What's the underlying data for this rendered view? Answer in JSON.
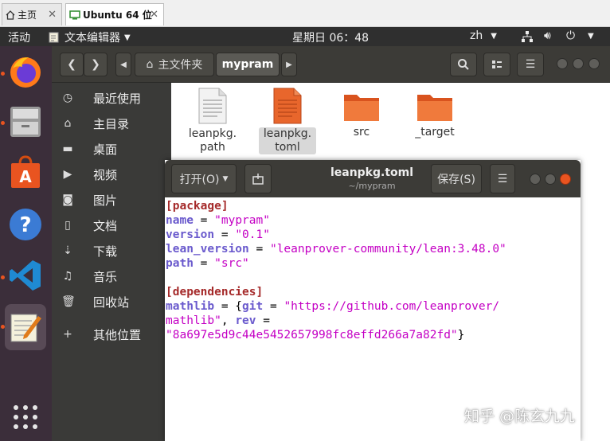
{
  "browser_tabs": [
    {
      "label": "主页",
      "icon": "home-icon"
    },
    {
      "label": "Ubuntu 64 位",
      "icon": "vm-icon"
    }
  ],
  "top_panel": {
    "activities": "活动",
    "app_menu": "文本编辑器",
    "clock": "星期日 06：48",
    "lang": "zh",
    "status_icons": [
      "network-icon",
      "volume-icon",
      "power-icon"
    ]
  },
  "dock": {
    "apps": [
      "firefox",
      "files",
      "software-center",
      "help",
      "vscode",
      "text-editor"
    ],
    "show_apps_icon": "grid-icon",
    "active": "text-editor"
  },
  "files": {
    "location_root": "主文件夹",
    "current_folder": "mypram",
    "sidebar": [
      {
        "label": "最近使用",
        "icon": "clock-icon"
      },
      {
        "label": "主目录",
        "icon": "home-icon"
      },
      {
        "label": "桌面",
        "icon": "folder-icon"
      },
      {
        "label": "视频",
        "icon": "video-icon"
      },
      {
        "label": "图片",
        "icon": "camera-icon"
      },
      {
        "label": "文档",
        "icon": "document-icon"
      },
      {
        "label": "下载",
        "icon": "download-icon"
      },
      {
        "label": "音乐",
        "icon": "music-icon"
      },
      {
        "label": "回收站",
        "icon": "trash-icon"
      },
      {
        "label": "其他位置",
        "icon": "plus-icon"
      }
    ],
    "items": [
      {
        "name1": "leanpkg.",
        "name2": "path",
        "type": "text-file"
      },
      {
        "name1": "leanpkg.",
        "name2": "toml",
        "type": "toml-file",
        "selected": true
      },
      {
        "name1": "src",
        "name2": "",
        "type": "folder"
      },
      {
        "name1": "_target",
        "name2": "",
        "type": "folder"
      }
    ]
  },
  "editor": {
    "open_label": "打开(O)",
    "save_label": "保存(S)",
    "title": "leanpkg.toml",
    "subtitle": "~/mypram",
    "lines": {
      "l1": "[package]",
      "l2k": "name",
      "l2v": "\"mypram\"",
      "l3k": "version",
      "l3v": "\"0.1\"",
      "l4k": "lean_version",
      "l4v": "\"leanprover-community/lean:3.48.0\"",
      "l5k": "path",
      "l5v": "\"src\"",
      "l7": "[dependencies]",
      "l8k": "mathlib",
      "l8k2": "git",
      "l8v": "\"https://github.com/leanprover/",
      "l9v": "mathlib\"",
      "l9k": "rev",
      "l10v": "\"8a697e5d9c44e5452657998fc8effd266a7a82fd\""
    }
  },
  "watermark": "知乎 @陈玄九九",
  "colors": {
    "accent": "#e95420",
    "dock": "#3b2e3a",
    "header": "#3c3b37",
    "sidebar": "#3a3a38",
    "section": "#a52a2a",
    "key": "#6a5acd",
    "string": "#c400c4"
  }
}
